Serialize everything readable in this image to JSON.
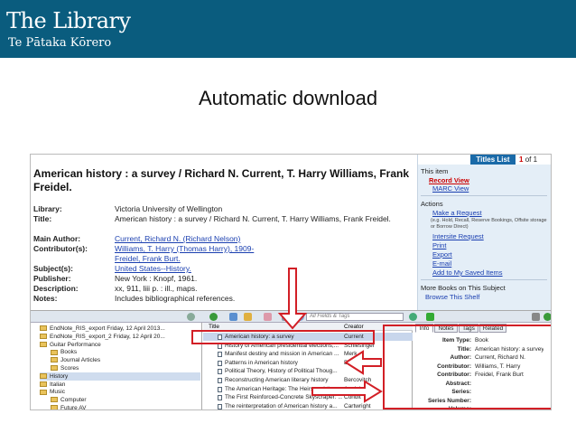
{
  "header": {
    "logo_main": "The Library",
    "logo_sub": "Te Pātaka Kōrero",
    "brand_color": "#0a5c7e"
  },
  "slide_title": "Automatic download",
  "record": {
    "title": "American history : a survey / Richard N. Current, T. Harry Williams, Frank Freidel.",
    "fields": [
      {
        "label": "Library:",
        "value": "Victoria University of Wellington"
      },
      {
        "label": "Title:",
        "value": "American history : a survey / Richard N. Current, T. Harry Williams, Frank Freidel."
      },
      {
        "label": "Main Author:",
        "value": "Current, Richard N. (Richard Nelson)"
      },
      {
        "label": "Contributor(s):",
        "value": "Williams, T. Harry (Thomas Harry), 1909-"
      },
      {
        "label": "",
        "value": "Freidel, Frank Burt."
      },
      {
        "label": "Subject(s):",
        "value": "United States--History."
      },
      {
        "label": "Publisher:",
        "value": "New York : Knopf, 1961."
      },
      {
        "label": "Description:",
        "value": "xx, 911, liii p. : ill., maps."
      },
      {
        "label": "Notes:",
        "value": "Includes bibliographical references."
      }
    ]
  },
  "side_panel": {
    "titles_list": "Titles List",
    "pager_current": "1",
    "pager_rest": "of 1",
    "this_item": "This item",
    "record_view": "Record View",
    "marc_view": "MARC View",
    "actions": "Actions",
    "make_request": "Make a Request",
    "make_request_note": "(e.g. Hold, Recall, Reserve Bookings, Offsite storage or Borrow Direct)",
    "intersite_request": "Intersite Request",
    "print": "Print",
    "export": "Export",
    "email": "E-mail",
    "add_saved": "Add to My Saved Items",
    "more_books": "More Books on This Subject",
    "browse_shelf": "Browse This Shelf"
  },
  "zotero": {
    "search_placeholder": "All Fields & Tags",
    "collections": [
      {
        "label": "EndNote_RIS_export Friday, 12 April 2013...",
        "indent": 1,
        "selected": false
      },
      {
        "label": "EndNote_RIS_export_2 Friday, 12 April 20...",
        "indent": 1,
        "selected": false
      },
      {
        "label": "Guitar Performance",
        "indent": 1,
        "selected": false
      },
      {
        "label": "Books",
        "indent": 2,
        "selected": false
      },
      {
        "label": "Journal Articles",
        "indent": 2,
        "selected": false
      },
      {
        "label": "Scores",
        "indent": 2,
        "selected": false
      },
      {
        "label": "History",
        "indent": 1,
        "selected": true
      },
      {
        "label": "Italian",
        "indent": 1,
        "selected": false
      },
      {
        "label": "Music",
        "indent": 1,
        "selected": false
      },
      {
        "label": "Computer",
        "indent": 2,
        "selected": false
      },
      {
        "label": "Future AV",
        "indent": 2,
        "selected": false
      }
    ],
    "items_header": {
      "title": "Title",
      "creator": "Creator"
    },
    "items": [
      {
        "title": "American history: a survey",
        "creator": "Current",
        "selected": true
      },
      {
        "title": "History of American presidential elections,...",
        "creator": "Schlesinger",
        "selected": false
      },
      {
        "title": "Manifest destiny and mission in American ...",
        "creator": "Merk",
        "selected": false
      },
      {
        "title": "Patterns in American history",
        "creator": "DeConde",
        "selected": false
      },
      {
        "title": "Political Theory, History of Political Thoug...",
        "creator": "",
        "selected": false
      },
      {
        "title": "Reconstructing American literary history",
        "creator": "Bercovitch",
        "selected": false
      },
      {
        "title": "The American Heritage: The Heirs and the ...",
        "creator": "Appleby",
        "selected": false
      },
      {
        "title": "The First Reinforced-Concrete Skyscraper: ...",
        "creator": "Condit",
        "selected": false
      },
      {
        "title": "The reinterpretation of American history a...",
        "creator": "Cartwright",
        "selected": false
      }
    ],
    "tabs": [
      "Info",
      "Notes",
      "Tags",
      "Related"
    ],
    "info": [
      {
        "label": "Item Type:",
        "value": "Book"
      },
      {
        "label": "Title:",
        "value": "American history: a survey"
      },
      {
        "label": "Author:",
        "value": "Current, Richard N."
      },
      {
        "label": "Contributor:",
        "value": "Williams, T. Harry"
      },
      {
        "label": "Contributor:",
        "value": "Freidel, Frank Burt"
      },
      {
        "label": "Abstract:",
        "value": ""
      },
      {
        "label": "Series:",
        "value": ""
      },
      {
        "label": "Series Number:",
        "value": ""
      },
      {
        "label": "Volume:",
        "value": ""
      }
    ]
  }
}
